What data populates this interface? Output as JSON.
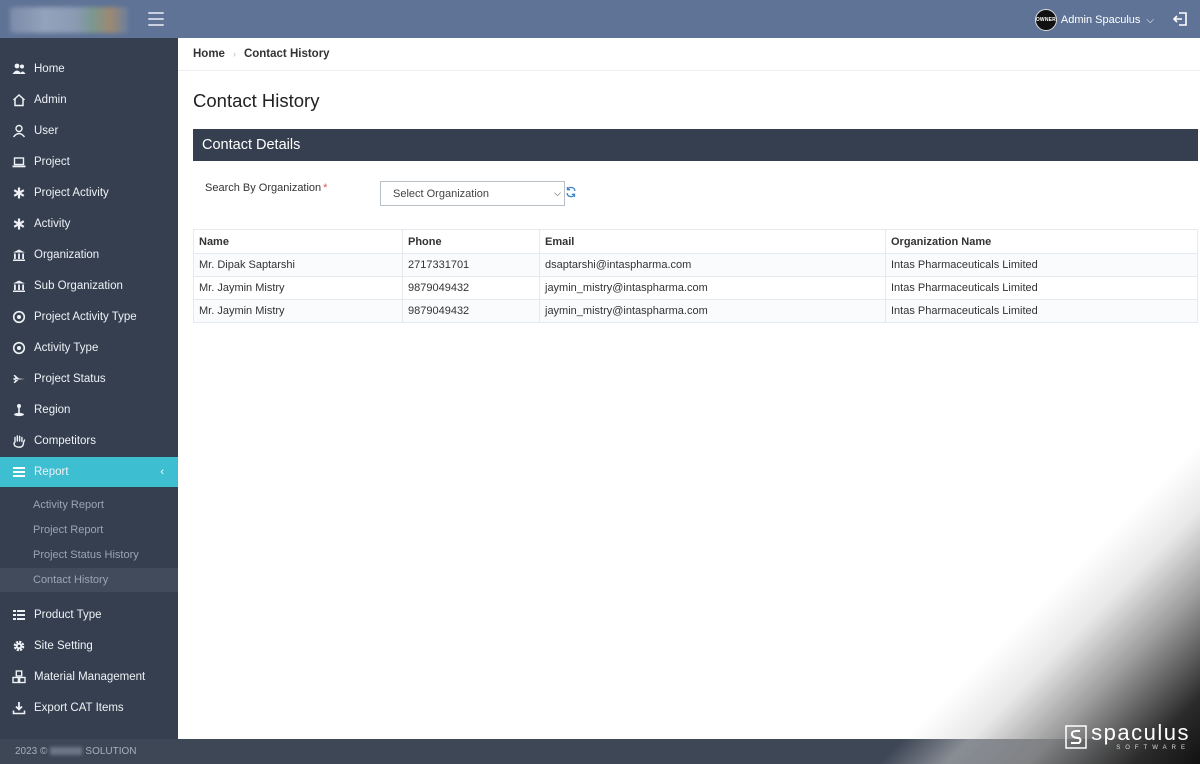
{
  "header": {
    "user_avatar_text": "OWNER",
    "user_name": "Admin Spaculus"
  },
  "sidebar": {
    "items": [
      {
        "label": "Home",
        "icon": "users-icon"
      },
      {
        "label": "Admin",
        "icon": "home-icon"
      },
      {
        "label": "User",
        "icon": "user-icon"
      },
      {
        "label": "Project",
        "icon": "laptop-icon"
      },
      {
        "label": "Project Activity",
        "icon": "asterisk-icon"
      },
      {
        "label": "Activity",
        "icon": "asterisk-icon"
      },
      {
        "label": "Organization",
        "icon": "bank-icon"
      },
      {
        "label": "Sub Organization",
        "icon": "bank-icon"
      },
      {
        "label": "Project Activity Type",
        "icon": "dot-circle-icon"
      },
      {
        "label": "Activity Type",
        "icon": "dot-circle-icon"
      },
      {
        "label": "Project Status",
        "icon": "plane-icon"
      },
      {
        "label": "Region",
        "icon": "region-icon"
      },
      {
        "label": "Competitors",
        "icon": "hand-icon"
      },
      {
        "label": "Report",
        "icon": "list-icon"
      },
      {
        "label": "Product Type",
        "icon": "list-alt-icon"
      },
      {
        "label": "Site Setting",
        "icon": "gear-icon"
      },
      {
        "label": "Material Management",
        "icon": "cubes-icon"
      },
      {
        "label": "Export CAT Items",
        "icon": "download-icon"
      }
    ],
    "report_sub": [
      {
        "label": "Activity Report"
      },
      {
        "label": "Project Report"
      },
      {
        "label": "Project Status History"
      },
      {
        "label": "Contact History"
      }
    ]
  },
  "breadcrumb": {
    "home": "Home",
    "current": "Contact History"
  },
  "page": {
    "title": "Contact History",
    "panel_title": "Contact Details",
    "search_label": "Search By Organization",
    "required_mark": "*",
    "select_value": "Select Organization"
  },
  "table": {
    "headers": [
      "Name",
      "Phone",
      "Email",
      "Organization Name"
    ],
    "rows": [
      [
        "Mr. Dipak Saptarshi",
        "2717331701",
        "dsaptarshi@intaspharma.com",
        "Intas Pharmaceuticals Limited"
      ],
      [
        "Mr. Jaymin Mistry",
        "9879049432",
        "jaymin_mistry@intaspharma.com",
        "Intas Pharmaceuticals Limited"
      ],
      [
        "Mr. Jaymin Mistry",
        "9879049432",
        "jaymin_mistry@intaspharma.com",
        "Intas Pharmaceuticals Limited"
      ]
    ]
  },
  "footer": {
    "year": "2023 ©",
    "company_suffix": "SOLUTION"
  },
  "watermark": {
    "name": "spaculus",
    "sub": "SOFTWARE"
  },
  "colors": {
    "topbar": "#5f7396",
    "sidebar": "#353f4f",
    "active": "#3ebed1",
    "panel_header": "#353f4f"
  }
}
